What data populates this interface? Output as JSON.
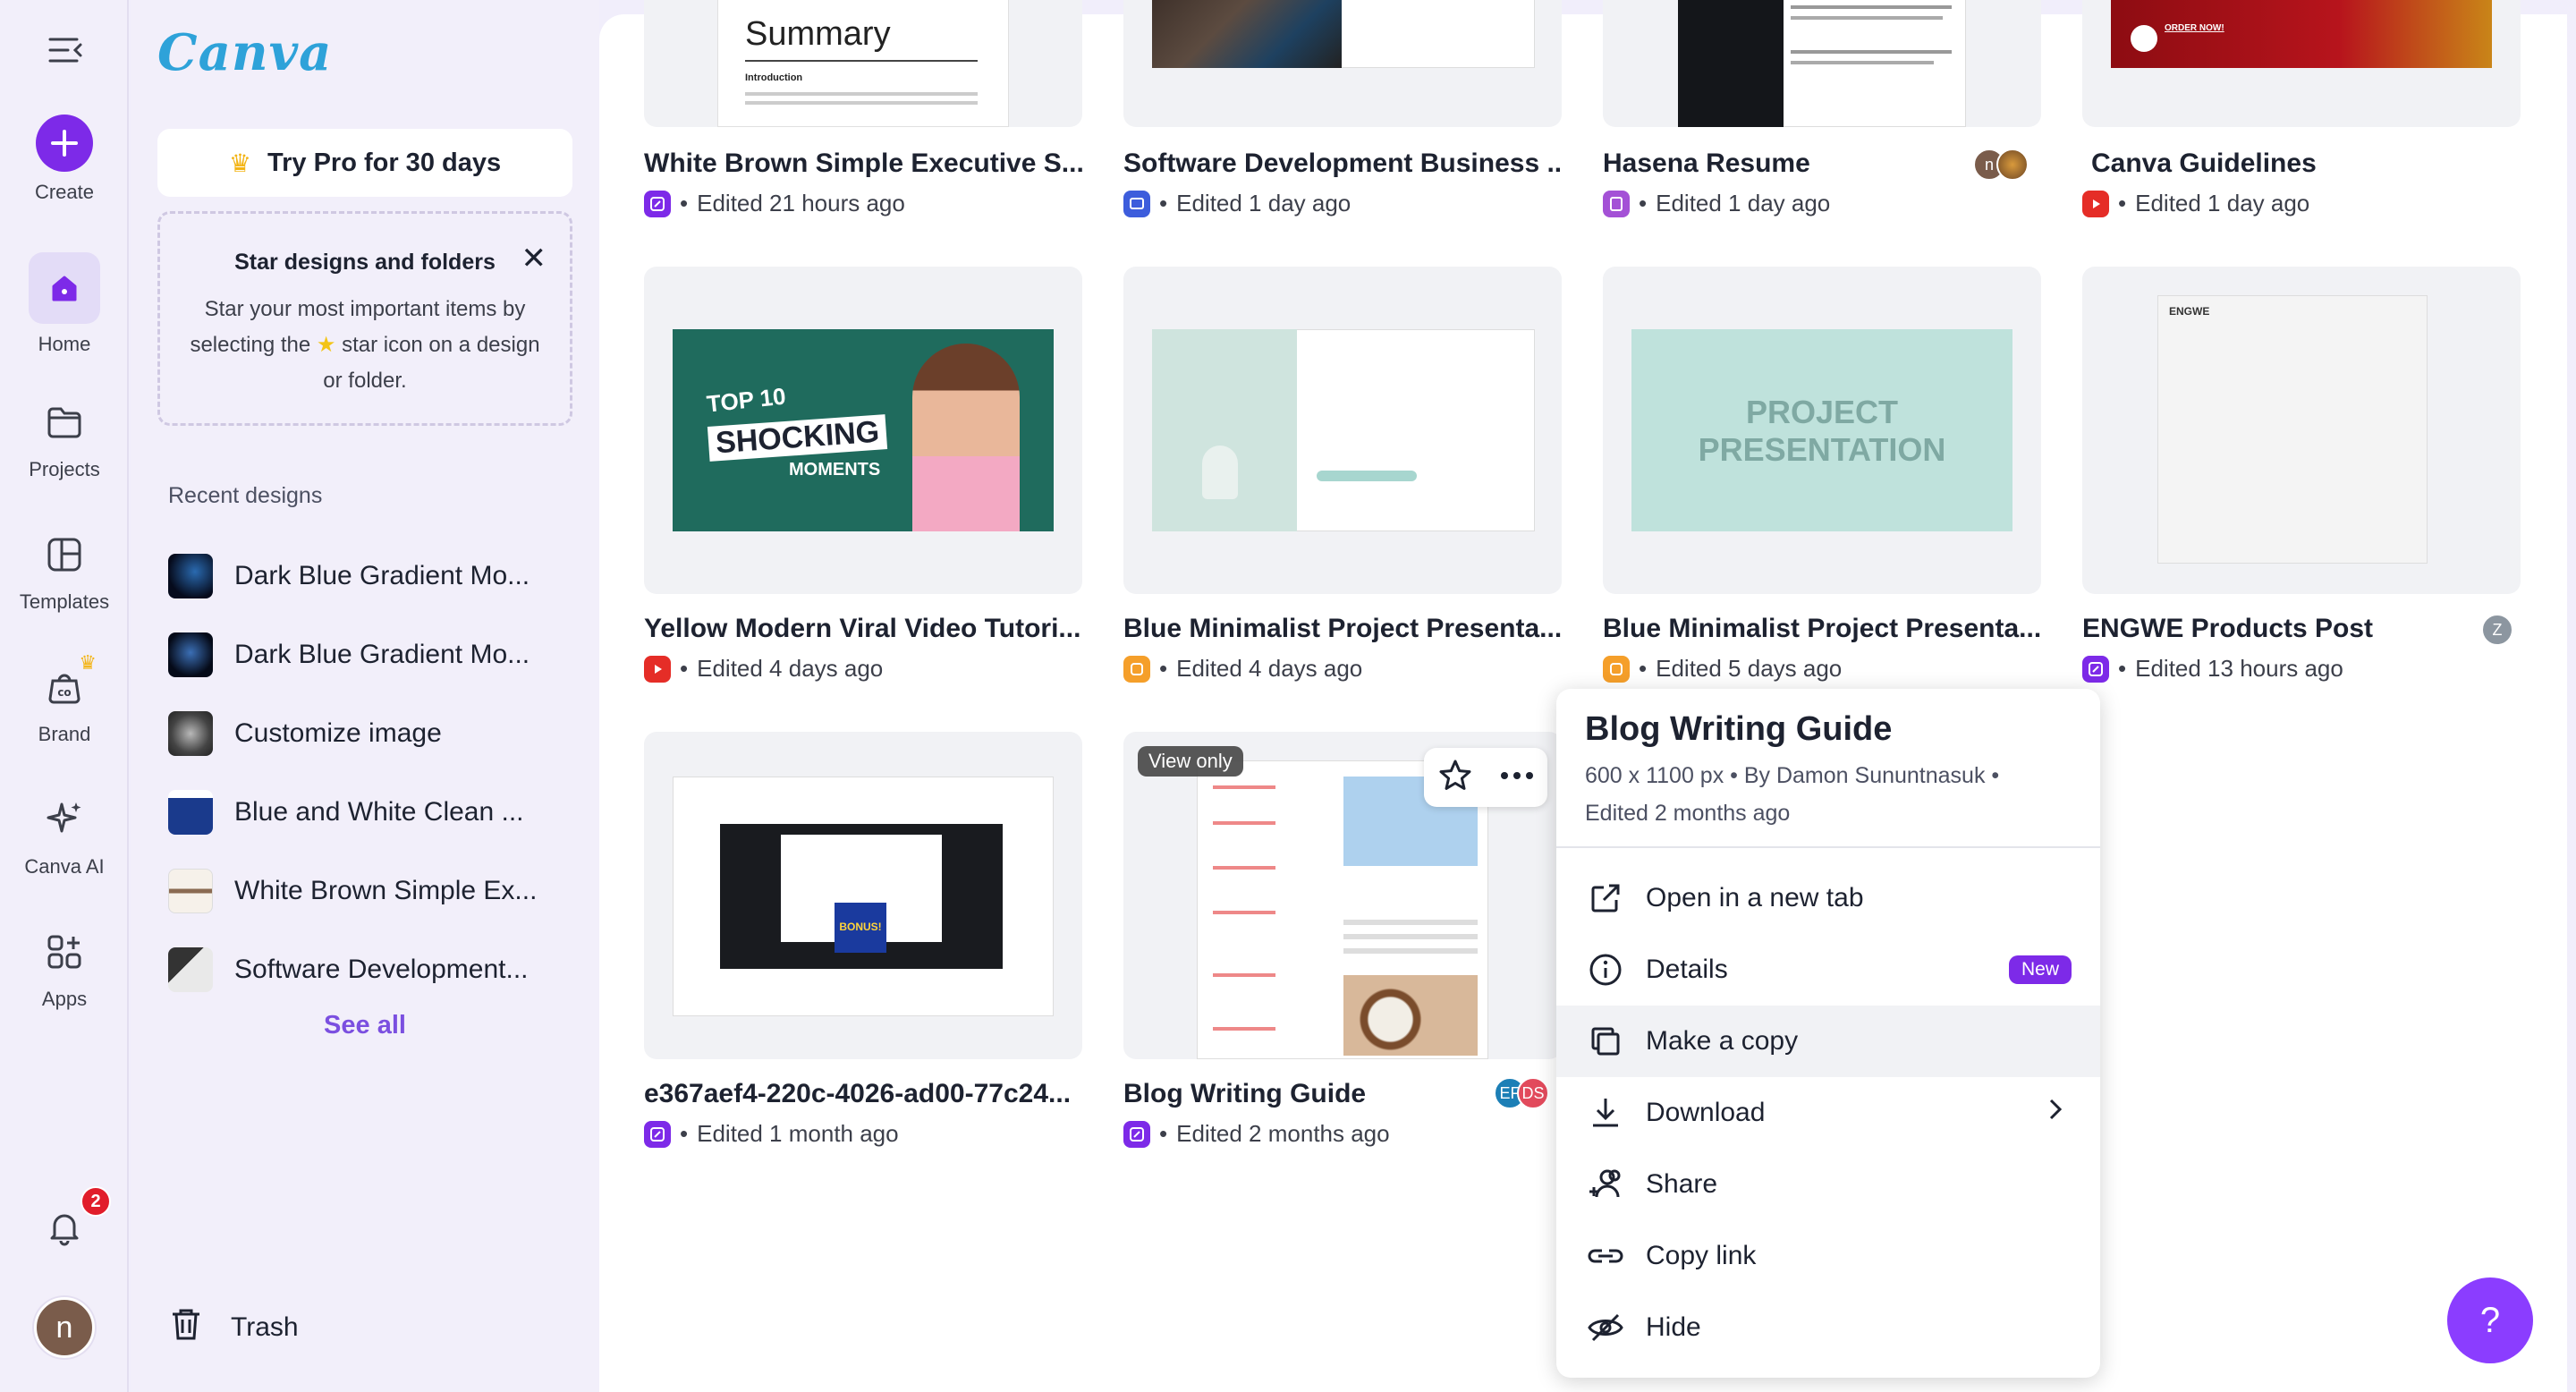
{
  "rail": {
    "create": "Create",
    "home": "Home",
    "projects": "Projects",
    "templates": "Templates",
    "brand": "Brand",
    "canva_ai": "Canva AI",
    "apps": "Apps",
    "notification_count": "2",
    "user_initial": "n"
  },
  "panel": {
    "logo": "Canva",
    "try_pro": "Try Pro for 30 days",
    "star_card": {
      "title": "Star designs and folders",
      "body_1": "Star your most important items by",
      "body_2a": "selecting the",
      "body_2b": "star icon on a design",
      "body_3": "or folder."
    },
    "recent_title": "Recent designs",
    "recent": [
      {
        "label": "Dark Blue Gradient Mo..."
      },
      {
        "label": "Dark Blue Gradient Mo..."
      },
      {
        "label": "Customize image"
      },
      {
        "label": "Blue and White Clean ..."
      },
      {
        "label": "White Brown Simple Ex..."
      },
      {
        "label": "Software Development..."
      }
    ],
    "see_all": "See all",
    "trash": "Trash"
  },
  "cards": [
    {
      "title": "White Brown Simple Executive S...",
      "meta": "Edited 21 hours ago",
      "thumb_text": "Summary",
      "thumb_sub": "Introduction"
    },
    {
      "title": "Software Development Business ...",
      "meta": "Edited 1 day ago"
    },
    {
      "title": "Hasena Resume",
      "meta": "Edited 1 day ago",
      "avatar": "n"
    },
    {
      "title": "Canva Guidelines",
      "meta": "Edited 1 day ago",
      "thumb_text": "ORDER NOW!"
    },
    {
      "title": "Yellow Modern Viral Video Tutori...",
      "meta": "Edited 4 days ago",
      "thumb_1": "TOP 10",
      "thumb_2": "SHOCKING",
      "thumb_3": "MOMENTS"
    },
    {
      "title": "Blue Minimalist Project Presenta...",
      "meta": "Edited 4 days ago"
    },
    {
      "title": "Blue Minimalist Project Presenta...",
      "meta": "Edited 5 days ago",
      "thumb_1": "PROJECT",
      "thumb_2": "PRESENTATION"
    },
    {
      "title": "ENGWE Products Post",
      "meta": "Edited 13 hours ago",
      "avatar": "Z",
      "thumb_text": "ENGWE"
    },
    {
      "title": "e367aef4-220c-4026-ad00-77c24...",
      "meta": "Edited 1 month ago",
      "thumb_text": "BONUS!"
    },
    {
      "title": "Blog Writing Guide",
      "meta": "Edited 2 months ago",
      "view_only": "View only",
      "avatar_1": "EF",
      "avatar_2": "DS"
    }
  ],
  "menu": {
    "title": "Blog Writing Guide",
    "sub_1": "600 x 1100 px • By Damon Sununtnasuk •",
    "sub_2": "Edited 2 months ago",
    "items": [
      {
        "label": "Open in a new tab"
      },
      {
        "label": "Details",
        "badge": "New"
      },
      {
        "label": "Make a copy"
      },
      {
        "label": "Download"
      },
      {
        "label": "Share"
      },
      {
        "label": "Copy link"
      },
      {
        "label": "Hide"
      }
    ]
  },
  "help": "?",
  "colors": {
    "accent": "#7d2ae8",
    "panel_bg": "#f2effa",
    "canva_blue": "#2ea2d9"
  }
}
